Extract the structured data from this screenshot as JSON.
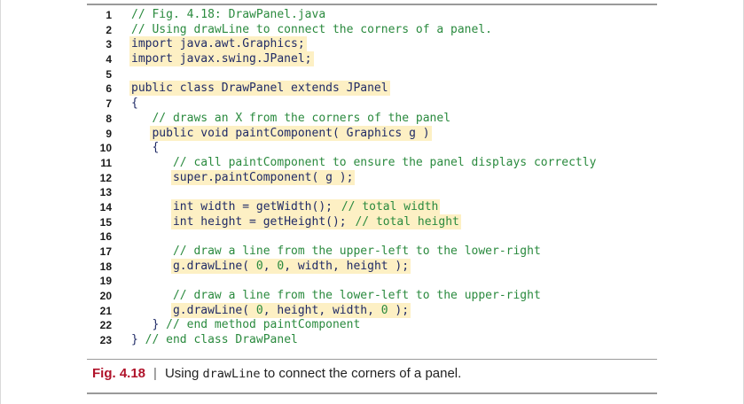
{
  "code_lines": [
    {
      "n": "1",
      "indent": "",
      "text": "// Fig. 4.18: DrawPanel.java",
      "kind": "comment",
      "hl": false
    },
    {
      "n": "2",
      "indent": "",
      "text": "// Using drawLine to connect the corners of a panel.",
      "kind": "comment",
      "hl": false
    },
    {
      "n": "3",
      "indent": "",
      "text": "import java.awt.Graphics;",
      "kind": "code",
      "hl": true
    },
    {
      "n": "4",
      "indent": "",
      "text": "import javax.swing.JPanel;",
      "kind": "code",
      "hl": true
    },
    {
      "n": "5",
      "indent": "",
      "text": "",
      "kind": "code",
      "hl": false
    },
    {
      "n": "6",
      "indent": "",
      "text": "public class DrawPanel extends JPanel",
      "kind": "code",
      "hl": true
    },
    {
      "n": "7",
      "indent": "",
      "text": "{",
      "kind": "code",
      "hl": false
    },
    {
      "n": "8",
      "indent": "   ",
      "text": "// draws an X from the corners of the panel",
      "kind": "comment",
      "hl": false
    },
    {
      "n": "9",
      "indent": "   ",
      "text": "public void paintComponent( Graphics g )",
      "kind": "code",
      "hl": true
    },
    {
      "n": "10",
      "indent": "   ",
      "text": "{",
      "kind": "code",
      "hl": false
    },
    {
      "n": "11",
      "indent": "      ",
      "text": "// call paintComponent to ensure the panel displays correctly",
      "kind": "comment",
      "hl": false
    },
    {
      "n": "12",
      "indent": "      ",
      "text": "super.paintComponent( g );",
      "kind": "code",
      "hl": true
    },
    {
      "n": "13",
      "indent": "",
      "text": "",
      "kind": "code",
      "hl": false
    },
    {
      "n": "14",
      "indent": "      ",
      "text": "int width = getWidth(); ",
      "trail": "// total width",
      "kind": "code",
      "hl": true
    },
    {
      "n": "15",
      "indent": "      ",
      "text": "int height = getHeight(); ",
      "trail": "// total height",
      "kind": "code",
      "hl": true
    },
    {
      "n": "16",
      "indent": "",
      "text": "",
      "kind": "code",
      "hl": false
    },
    {
      "n": "17",
      "indent": "      ",
      "text": "// draw a line from the upper-left to the lower-right",
      "kind": "comment",
      "hl": false
    },
    {
      "n": "18",
      "indent": "      ",
      "text": "g.drawLine( 0, 0, width, height );",
      "kind": "code",
      "hl": true
    },
    {
      "n": "19",
      "indent": "",
      "text": "",
      "kind": "code",
      "hl": false
    },
    {
      "n": "20",
      "indent": "      ",
      "text": "// draw a line from the lower-left to the upper-right",
      "kind": "comment",
      "hl": false
    },
    {
      "n": "21",
      "indent": "      ",
      "text": "g.drawLine( 0, height, width, 0 );",
      "kind": "code",
      "hl": true
    },
    {
      "n": "22",
      "indent": "   ",
      "text": "} ",
      "trail": "// end method paintComponent",
      "kind": "code",
      "hl": false
    },
    {
      "n": "23",
      "indent": "",
      "text": "} ",
      "trail": "// end class DrawPanel",
      "kind": "code",
      "hl": false
    }
  ],
  "caption": {
    "label": "Fig. 4.18",
    "separator": "|",
    "text_before": "Using ",
    "code_word": "drawLine",
    "text_after": " to connect the corners of a panel."
  },
  "colors": {
    "comment": "#2a8a3e",
    "code": "#1f2a66",
    "highlight": "#fdf0c4",
    "figure_label": "#b0132a"
  }
}
